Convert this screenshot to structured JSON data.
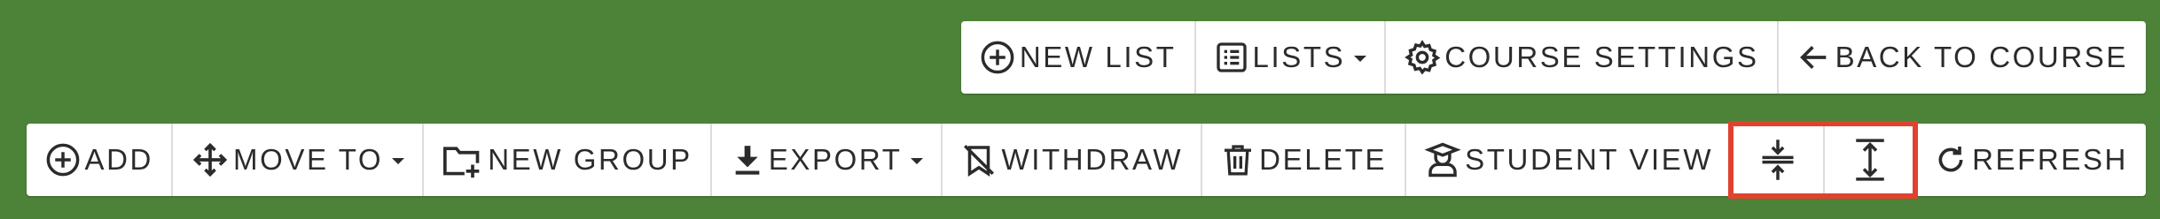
{
  "colors": {
    "background": "#4d8339",
    "toolbar_bg": "#ffffff",
    "text": "#2b2b2b",
    "divider": "#dcdcdc",
    "highlight": "#e2412f"
  },
  "top_toolbar": {
    "new_list_label": "NEW LIST",
    "lists_label": "LISTS",
    "course_settings_label": "COURSE SETTINGS",
    "back_to_course_label": "BACK TO COURSE",
    "icons": {
      "new_list": "plus-circle-icon",
      "lists": "list-icon",
      "course_settings": "gear-icon",
      "back_to_course": "arrow-left-icon"
    }
  },
  "bottom_toolbar": {
    "add_label": "ADD",
    "move_to_label": "MOVE TO",
    "new_group_label": "NEW GROUP",
    "export_label": "EXPORT",
    "withdraw_label": "WITHDRAW",
    "delete_label": "DELETE",
    "student_view_label": "STUDENT VIEW",
    "refresh_label": "REFRESH",
    "icons": {
      "add": "plus-circle-icon",
      "move_to": "move-arrows-icon",
      "new_group": "folder-plus-icon",
      "export": "download-icon",
      "withdraw": "bookmark-off-icon",
      "delete": "trash-icon",
      "student_view": "student-icon",
      "collapse_all": "collapse-vertical-icon",
      "expand_all": "expand-vertical-icon",
      "refresh": "refresh-icon"
    }
  }
}
